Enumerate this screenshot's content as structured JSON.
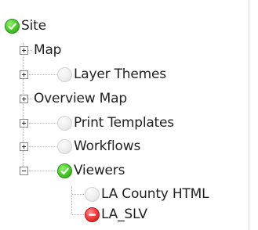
{
  "tree": {
    "root": {
      "label": "Site",
      "status": "ok",
      "status_icon": "green-check-icon"
    },
    "items": [
      {
        "label": "Map",
        "status": "none",
        "toggle": "expand"
      },
      {
        "label": "Layer Themes",
        "status": "inactive",
        "toggle": "expand",
        "status_icon": "grey-circle-icon"
      },
      {
        "label": "Overview Map",
        "status": "none",
        "toggle": "expand"
      },
      {
        "label": "Print Templates",
        "status": "inactive",
        "toggle": "expand",
        "status_icon": "grey-circle-icon"
      },
      {
        "label": "Workflows",
        "status": "inactive",
        "toggle": "expand",
        "status_icon": "grey-circle-icon"
      },
      {
        "label": "Viewers",
        "status": "ok",
        "toggle": "collapse",
        "status_icon": "green-check-icon",
        "children": [
          {
            "label": "LA County HTML",
            "status": "inactive",
            "status_icon": "grey-circle-icon"
          },
          {
            "label": "LA_SLV",
            "status": "error",
            "status_icon": "red-minus-icon"
          }
        ]
      }
    ]
  },
  "colors": {
    "ok": "#4fcf2c",
    "inactive": "#e6e6e6",
    "error": "#ef3d3d",
    "connector": "#b5b5b5"
  }
}
